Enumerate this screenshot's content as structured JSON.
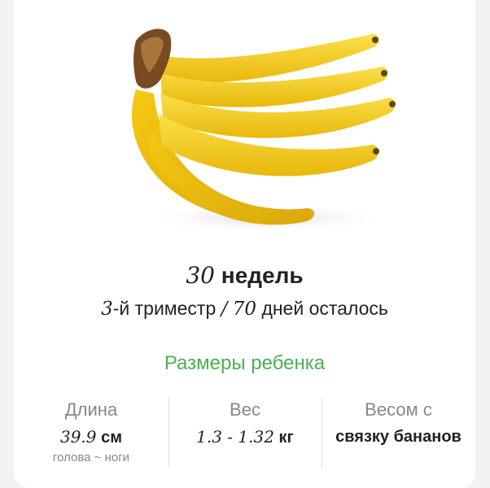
{
  "header": {
    "week_number": "30",
    "week_word": "недель",
    "trimester_number": "3",
    "trimester_text": "-й триместр",
    "separator": "/",
    "days_number": "70",
    "days_text": "дней осталось"
  },
  "section": {
    "title": "Размеры ребенка"
  },
  "stats": [
    {
      "label": "Длина",
      "value_number": "39.9",
      "value_unit": "см",
      "note": "голова ~ ноги"
    },
    {
      "label": "Вес",
      "value_number": "1.3 - 1.32",
      "value_unit": "кг"
    },
    {
      "label": "Весом с",
      "value_text": "связку бананов"
    }
  ],
  "colors": {
    "accent_green": "#4caf50",
    "banana_yellow": "#f7d21b",
    "stem_brown": "#7a4a22"
  }
}
